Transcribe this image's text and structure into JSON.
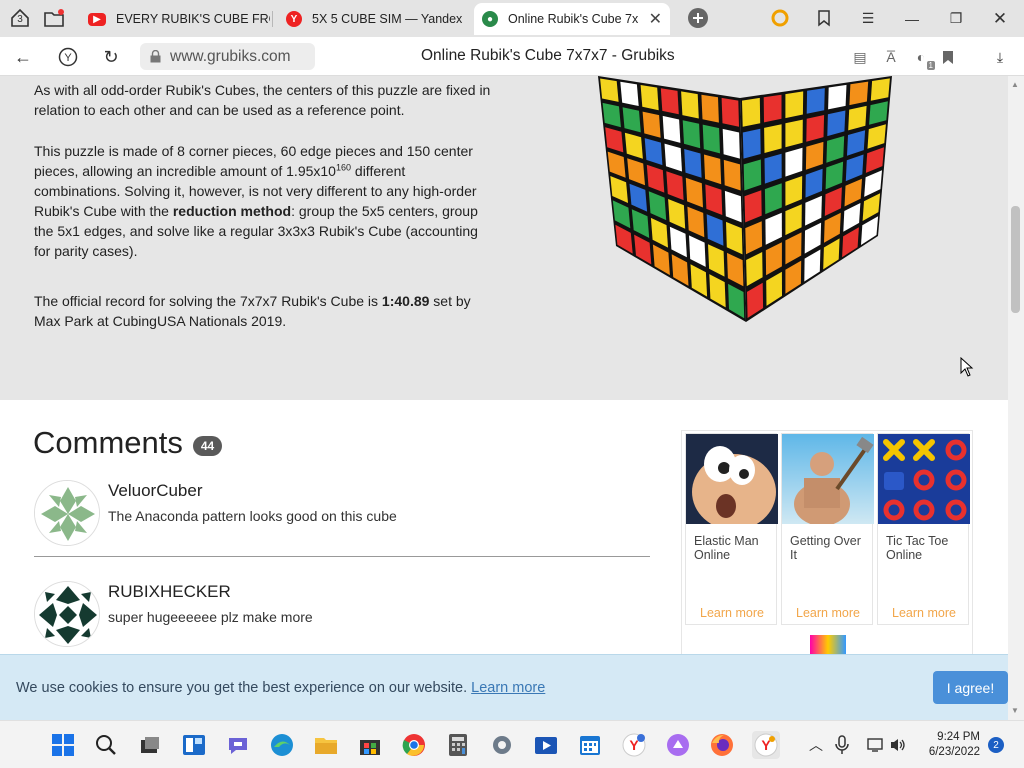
{
  "browser": {
    "tab_count": "3",
    "tabs": [
      {
        "label": "EVERY RUBIK'S CUBE FRO",
        "icon": "youtube-icon"
      },
      {
        "label": "5X 5 CUBE SIM — Yandex",
        "icon": "yandex-icon"
      },
      {
        "label": "Online Rubik's Cube 7x",
        "icon": "grubiks-icon",
        "active": true
      }
    ],
    "address": "www.grubiks.com",
    "page_title": "Online Rubik's Cube 7x7x7 - Grubiks",
    "tool_badge": "1"
  },
  "article": {
    "p1": "As with all odd-order Rubik's Cubes, the centers of this puzzle are fixed in relation to each other and can be used as a reference point.",
    "p2_a": "This puzzle is made of 8 corner pieces, 60 edge pieces and 150 center pieces, allowing an incredible amount of 1.95x10",
    "p2_sup": "160",
    "p2_b": " different combinations. Solving it, however, is not very different to any high-order Rubik's Cube with the ",
    "p2_bold": "reduction method",
    "p2_c": ": group the 5x5 centers, group the 5x1 edges, and solve like a regular 3x3x3 Rubik's Cube (accounting for parity cases).",
    "p3_a": "The official record for solving the 7x7x7 Rubik's Cube is ",
    "p3_bold": "1:40.89",
    "p3_b": " set by Max Park at CubingUSA Nationals 2019."
  },
  "comments": {
    "title": "Comments",
    "count": "44",
    "items": [
      {
        "author": "VeluorCuber",
        "text": "The Anaconda pattern looks good on this cube"
      },
      {
        "author": "RUBIXHECKER",
        "text": "super hugeeeeee plz make more"
      }
    ]
  },
  "ads": {
    "cards": [
      {
        "title": "Elastic Man Online",
        "link": "Learn more"
      },
      {
        "title": "Getting Over It",
        "link": "Learn more"
      },
      {
        "title": "Tic Tac Toe Online",
        "link": "Learn more"
      }
    ]
  },
  "cookie": {
    "text": "We use cookies to ensure you get the best experience on our website.",
    "link": "Learn more",
    "button": "I agree!"
  },
  "taskbar": {
    "time": "9:24 PM",
    "date": "6/23/2022",
    "notifications": "2"
  },
  "colors": {
    "accent_blue": "#4a90d9",
    "cookie_bg": "#d5e9f5",
    "ad_link": "#f2a64a",
    "cube": [
      "#e8312e",
      "#f39019",
      "#f4d520",
      "#2fa84f",
      "#2f6fd6",
      "#ffffff"
    ]
  }
}
